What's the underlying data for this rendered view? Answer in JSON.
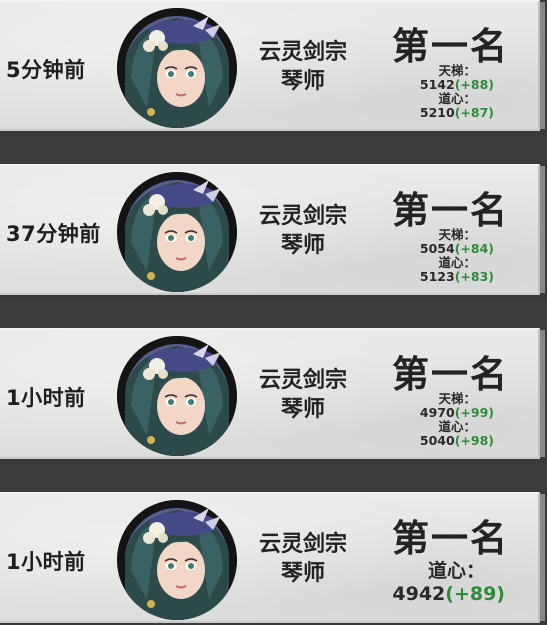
{
  "colors": {
    "delta_green": "#2f8a3a",
    "card_bg": "#e3e3e3",
    "gap_bg": "#3b3b3b"
  },
  "entries": [
    {
      "time": "5分钟前",
      "sect": "云灵剑宗",
      "role": "琴师",
      "rank": "第一名",
      "ladder_label": "天梯：",
      "ladder_score": "5142",
      "ladder_delta": "(+88)",
      "dao_label": "道心：",
      "dao_score": "5210",
      "dao_delta": "(+87)",
      "avatar_icon": "portrait-avatar-icon"
    },
    {
      "time": "37分钟前",
      "sect": "云灵剑宗",
      "role": "琴师",
      "rank": "第一名",
      "ladder_label": "天梯：",
      "ladder_score": "5054",
      "ladder_delta": "(+84)",
      "dao_label": "道心：",
      "dao_score": "5123",
      "dao_delta": "(+83)",
      "avatar_icon": "portrait-avatar-icon"
    },
    {
      "time": "1小时前",
      "sect": "云灵剑宗",
      "role": "琴师",
      "rank": "第一名",
      "ladder_label": "天梯：",
      "ladder_score": "4970",
      "ladder_delta": "(+99)",
      "dao_label": "道心：",
      "dao_score": "5040",
      "dao_delta": "(+98)",
      "avatar_icon": "portrait-avatar-icon"
    },
    {
      "time": "1小时前",
      "sect": "云灵剑宗",
      "role": "琴师",
      "rank": "第一名",
      "dao_label": "道心：",
      "dao_score": "4942",
      "dao_delta": "(+89)",
      "avatar_icon": "portrait-avatar-icon"
    }
  ]
}
